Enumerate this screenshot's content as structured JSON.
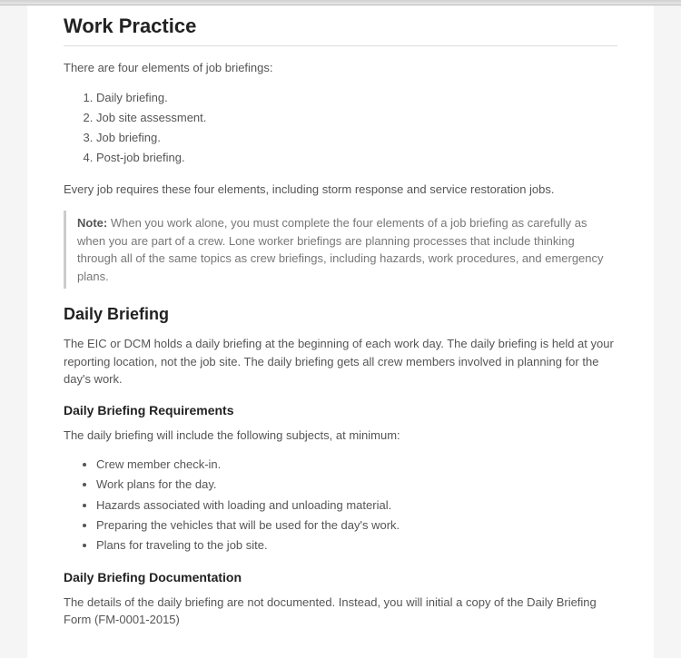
{
  "heading": "Work Practice",
  "intro": "There are four elements of job briefings:",
  "elements": [
    "Daily briefing.",
    "Job site assessment.",
    "Job briefing.",
    "Post-job briefing."
  ],
  "everyJob": "Every job requires these four elements, including storm response and service restoration jobs.",
  "note": {
    "label": "Note:",
    "text": "When you work alone, you must complete the four elements of a job briefing as carefully as when you are part of a crew. Lone worker briefings are planning processes that include thinking through all of the same topics as crew briefings, including hazards, work procedures, and emergency plans."
  },
  "dailyBriefing": {
    "heading": "Daily Briefing",
    "text": "The EIC or DCM holds a daily briefing at the beginning of each work day. The daily briefing is held at your reporting location, not the job site. The daily briefing gets all crew members involved in planning for the day's work."
  },
  "requirements": {
    "heading": "Daily Briefing Requirements",
    "intro": "The daily briefing will include the following subjects, at minimum:",
    "items": [
      "Crew member check-in.",
      "Work plans for the day.",
      "Hazards associated with loading and unloading material.",
      "Preparing the vehicles that will be used for the day's work.",
      "Plans for traveling to the job site."
    ]
  },
  "documentation": {
    "heading": "Daily Briefing Documentation",
    "text": "The details of the daily briefing are not documented. Instead, you will initial a copy of the Daily Briefing Form (FM-0001-2015)"
  }
}
